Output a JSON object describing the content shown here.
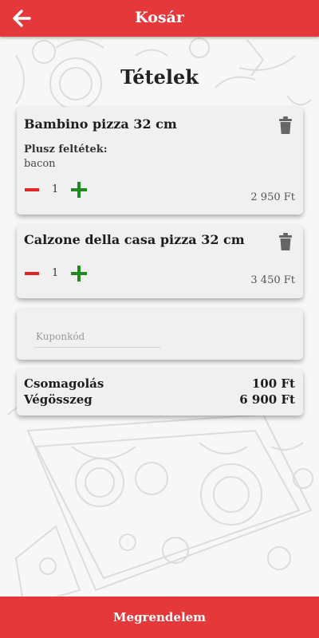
{
  "header": {
    "title": "Kosár",
    "back_icon": "arrow-left-icon"
  },
  "main": {
    "heading": "Tételek"
  },
  "items": [
    {
      "name": "Bambino pizza 32 cm",
      "extras_label": "Plusz feltétek:",
      "extras": "bacon",
      "quantity": "1",
      "price": "2 950 Ft"
    },
    {
      "name": "Calzone della casa pizza 32 cm",
      "quantity": "1",
      "price": "3 450 Ft"
    }
  ],
  "coupon": {
    "placeholder": "Kuponkód",
    "value": ""
  },
  "summary": {
    "packaging_label": "Csomagolás",
    "packaging_value": "100 Ft",
    "total_label": "Végösszeg",
    "total_value": "6 900 Ft"
  },
  "footer": {
    "order_button": "Megrendelem"
  },
  "colors": {
    "accent": "#e5383b",
    "minus": "#e32424",
    "plus": "#1f8a1f",
    "card": "#f0f0f0"
  }
}
